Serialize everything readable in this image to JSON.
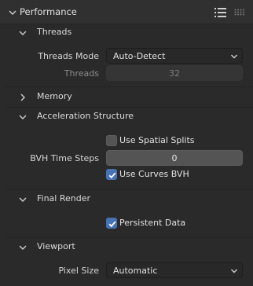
{
  "panel": {
    "title": "Performance"
  },
  "threads": {
    "title": "Threads",
    "mode_label": "Threads Mode",
    "mode_value": "Auto-Detect",
    "threads_label": "Threads",
    "threads_value": "32"
  },
  "memory": {
    "title": "Memory"
  },
  "acceleration": {
    "title": "Acceleration Structure",
    "spatial_splits_label": "Use Spatial Splits",
    "spatial_splits_checked": false,
    "bvh_steps_label": "BVH Time Steps",
    "bvh_steps_value": "0",
    "curves_bvh_label": "Use Curves BVH",
    "curves_bvh_checked": true
  },
  "final_render": {
    "title": "Final Render",
    "persistent_label": "Persistent Data",
    "persistent_checked": true
  },
  "viewport": {
    "title": "Viewport",
    "pixel_size_label": "Pixel Size",
    "pixel_size_value": "Automatic"
  },
  "colors": {
    "accent": "#4772b3",
    "background": "#2a2a2a"
  },
  "icons": [
    "chevron-down-icon",
    "chevron-right-icon",
    "list-icon",
    "drag-grip-icon",
    "checkmark-icon"
  ]
}
